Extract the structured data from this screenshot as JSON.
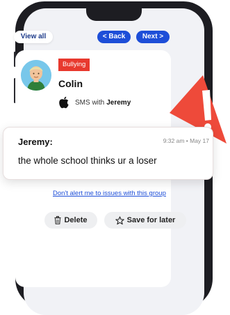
{
  "nav": {
    "view_all": "View all",
    "back": "< Back",
    "next": "Next >"
  },
  "alert": {
    "category": "Bullying",
    "child_name": "Colin",
    "app_label": "SMS with",
    "contact_name": "Jeremy",
    "app_icon": "apple-icon"
  },
  "message": {
    "sender": "Jeremy:",
    "time": "9:32 am • May 17",
    "text": "the whole school thinks ur a loser"
  },
  "actions": {
    "dont_alert": "Don't alert me to issues with this group",
    "delete": "Delete",
    "save": "Save for later"
  },
  "colors": {
    "accent": "#1d4ed8",
    "alert_red": "#e8392e"
  }
}
